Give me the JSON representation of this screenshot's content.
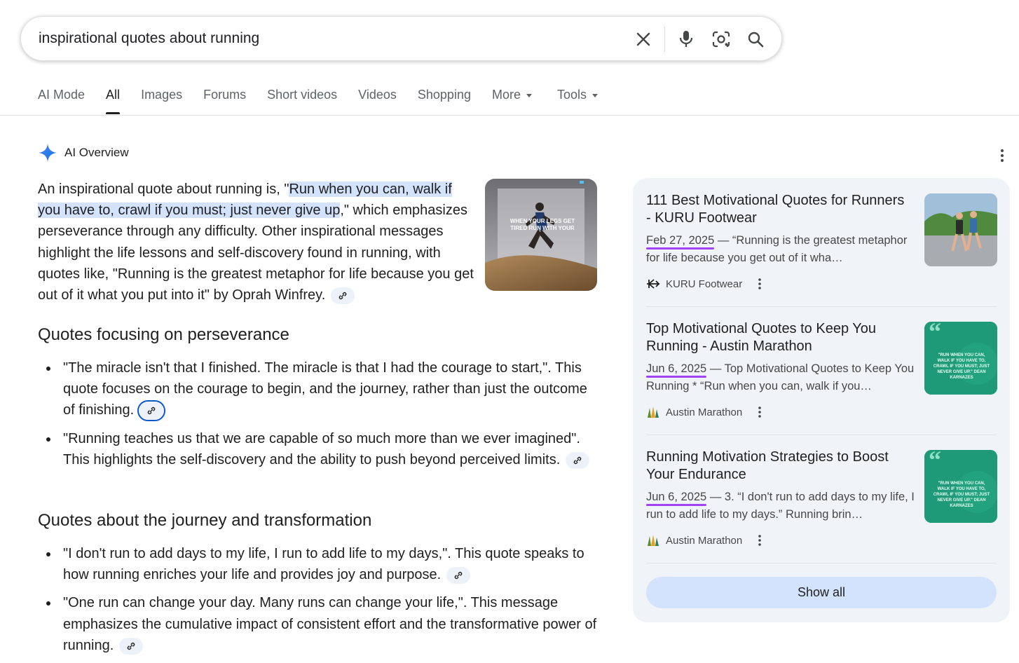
{
  "search": {
    "query": "inspirational quotes about running"
  },
  "tabs": [
    {
      "label": "AI Mode",
      "active": false
    },
    {
      "label": "All",
      "active": true
    },
    {
      "label": "Images",
      "active": false
    },
    {
      "label": "Forums",
      "active": false
    },
    {
      "label": "Short videos",
      "active": false
    },
    {
      "label": "Videos",
      "active": false
    },
    {
      "label": "Shopping",
      "active": false
    },
    {
      "label": "More",
      "active": false
    },
    {
      "label": "Tools",
      "active": false
    }
  ],
  "overview": {
    "title": "AI Overview",
    "intro_prefix": "An inspirational quote about running is, \"",
    "intro_highlight": "Run when you can, walk if you have to, crawl if you must; just never give up",
    "intro_suffix": ",\" which empha­sizes perseverance through any difficulty. Other inspirational mes­sages highlight the life lessons and self-discovery found in running, with quotes like, \"Running is the greatest metaphor for life because you get out of it what you put into it\" by Oprah Winfrey.",
    "hero_image_text": "WHEN YOUR LEGS GET TIRED RUN WITH YOUR"
  },
  "sections": [
    {
      "heading": "Quotes focusing on perseverance",
      "bullets": [
        "\"The miracle isn't that I finished. The miracle is that I had the courage to start,\". This quote focuses on the courage to begin, and the journey, rather than just the outcome of finishing.",
        "\"Running teaches us that we are capable of so much more than we ever imagined\". This highlights the self-discovery and the ability to push beyond perceived limits."
      ]
    },
    {
      "heading": "Quotes about the journey and transformation",
      "bullets": [
        "\"I don't run to add days to my life, I run to add life to my days,\". This quote speaks to how running enriches your life and provides joy and purpose.",
        "\"One run can change your day. Many runs can change your life,\". This message emphasizes the cumulative impact of consistent effort and the transformative power of running."
      ]
    }
  ],
  "sources": [
    {
      "title": "111 Best Motivational Quotes for Runners - KURU Footwear",
      "date": "Feb 27, 2025",
      "snippet": " — “Running is the greatest metaphor for life because you get out of it wha…",
      "site": "KURU Footwear",
      "icon": "kuru-logo-icon"
    },
    {
      "title": "Top Motivational Quotes to Keep You Running - Austin Marathon",
      "date": "Jun 6, 2025",
      "snippet": " — Top Motivational Quotes to Keep You Running * “Run when you can, walk if you…",
      "site": "Austin Marathon",
      "icon": "austin-marathon-logo-icon",
      "thumb_text": "\"RUN WHEN YOU CAN, WALK IF YOU HAVE TO, CRAWL IF YOU MUST; JUST NEVER GIVE UP.\" DEAN KARNAZES"
    },
    {
      "title": "Running Motivation Strategies to Boost Your Endurance",
      "date": "Jun 6, 2025",
      "snippet": " — 3. “I don't run to add days to my life, I run to add life to my days.” Running brin…",
      "site": "Austin Marathon",
      "icon": "austin-marathon-logo-icon",
      "thumb_text": "\"RUN WHEN YOU CAN, WALK IF YOU HAVE TO, CRAWL IF YOU MUST; JUST NEVER GIVE UP.\" DEAN KARNAZES"
    }
  ],
  "show_all_label": "Show all",
  "colors": {
    "highlight": "#d3e3fd",
    "panel_bg": "#f0f4f9",
    "date_underline": "#a142f4",
    "gemini_blue": "#4285f4"
  }
}
